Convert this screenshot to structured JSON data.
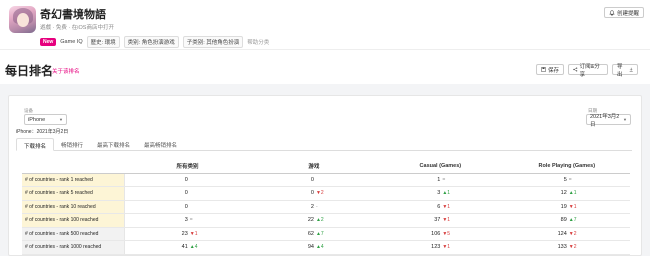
{
  "app": {
    "title": "奇幻書境物語",
    "subtitle": "遊戲 · 免费 · 在iOS商店中打开",
    "tags": {
      "new": "New",
      "gameiq": "Game IQ",
      "genre": "歴史: 環境",
      "category": "类别: 角色扮演游戏",
      "subcategory": "子类别: 其他角色扮演",
      "help": "帮助分类"
    },
    "create_label": "创建提醒"
  },
  "page": {
    "title": "每日排名",
    "subtitle": "关于该排名",
    "save_label": "保存",
    "subscribe_label": "订阅&分享",
    "export_label": "导出"
  },
  "filters": {
    "device_label": "设备",
    "device_value": "iPhone",
    "date_label": "日期",
    "date_value": "2021年3月2日",
    "date_info": "iPhone：2021年3月2日"
  },
  "tabs": [
    "下载排名",
    "畅销排行",
    "最高下载排名",
    "最高畅销排名"
  ],
  "table": {
    "columns": [
      "所有类别",
      "游戏",
      "Casual (Games)",
      "Role Playing (Games)"
    ],
    "rows": [
      {
        "label": "# of countries - rank 1 reached",
        "highlight": true,
        "cells": [
          {
            "v": "0",
            "d": "",
            "t": ""
          },
          {
            "v": "0",
            "d": "",
            "t": ""
          },
          {
            "v": "1",
            "d": "=",
            "t": "eq"
          },
          {
            "v": "5",
            "d": "=",
            "t": "eq"
          }
        ]
      },
      {
        "label": "# of countries - rank 5 reached",
        "highlight": true,
        "cells": [
          {
            "v": "0",
            "d": "",
            "t": ""
          },
          {
            "v": "0",
            "d": "▼2",
            "t": "down"
          },
          {
            "v": "3",
            "d": "▲1",
            "t": "up"
          },
          {
            "v": "12",
            "d": "▲1",
            "t": "up"
          }
        ]
      },
      {
        "label": "# of countries - rank 10 reached",
        "highlight": true,
        "cells": [
          {
            "v": "0",
            "d": "",
            "t": ""
          },
          {
            "v": "2",
            "d": "-",
            "t": "eq"
          },
          {
            "v": "6",
            "d": "▼1",
            "t": "down"
          },
          {
            "v": "19",
            "d": "▼1",
            "t": "down"
          }
        ]
      },
      {
        "label": "# of countries - rank 100 reached",
        "highlight": true,
        "cells": [
          {
            "v": "3",
            "d": "=",
            "t": "eq"
          },
          {
            "v": "22",
            "d": "▲2",
            "t": "up"
          },
          {
            "v": "37",
            "d": "▼1",
            "t": "down"
          },
          {
            "v": "89",
            "d": "▲7",
            "t": "up"
          }
        ]
      },
      {
        "label": "# of countries - rank 500 reached",
        "highlight": false,
        "cells": [
          {
            "v": "23",
            "d": "▼1",
            "t": "down"
          },
          {
            "v": "62",
            "d": "▲7",
            "t": "up"
          },
          {
            "v": "106",
            "d": "▼5",
            "t": "down"
          },
          {
            "v": "124",
            "d": "▼2",
            "t": "down"
          }
        ]
      },
      {
        "label": "# of countries - rank 1000 reached",
        "highlight": false,
        "cells": [
          {
            "v": "41",
            "d": "▲4",
            "t": "up"
          },
          {
            "v": "94",
            "d": "▲4",
            "t": "up"
          },
          {
            "v": "123",
            "d": "▼1",
            "t": "down"
          },
          {
            "v": "133",
            "d": "▼2",
            "t": "down"
          }
        ]
      }
    ]
  },
  "colors": {
    "accent": "#e6007e",
    "row_highlight": "#fdf5d6",
    "row_normal": "#f2f2f2",
    "up": "#2ea043",
    "down": "#d63a3a"
  }
}
